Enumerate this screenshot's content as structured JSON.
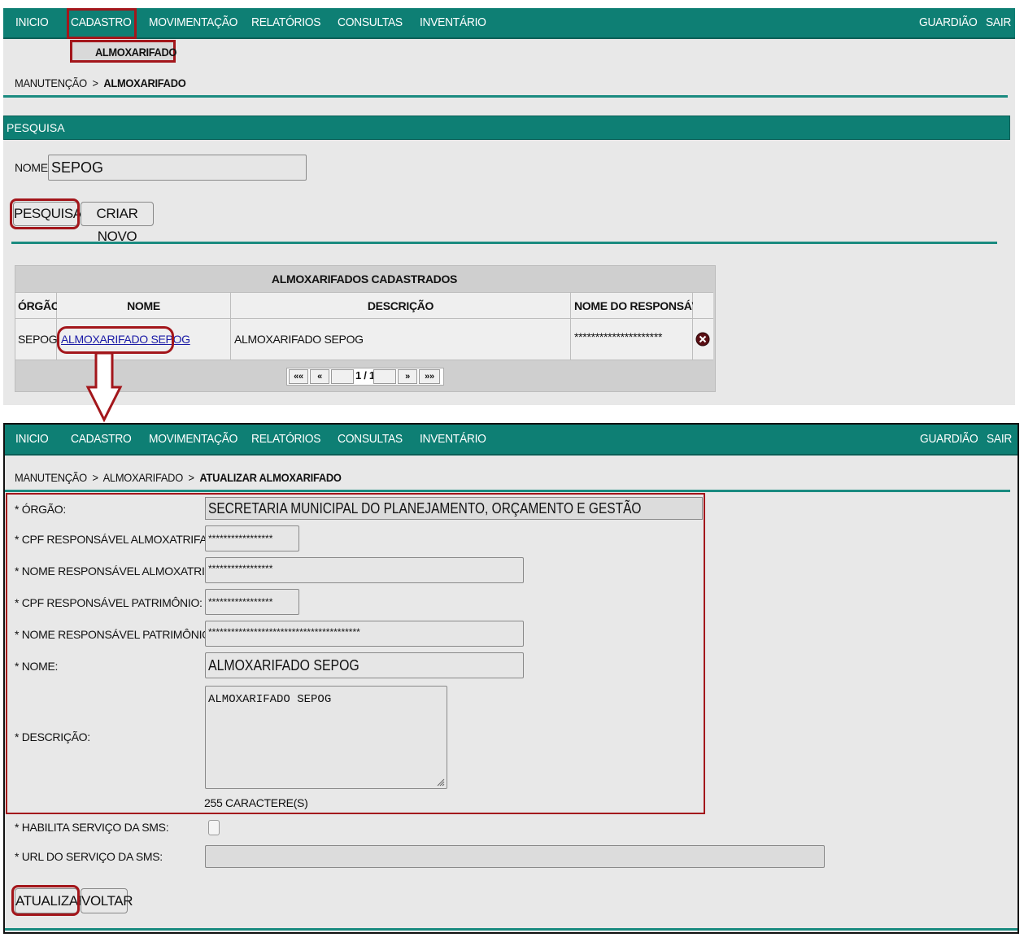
{
  "nav": {
    "items": [
      "INICIO",
      "CADASTRO",
      "MOVIMENTAÇÃO",
      "RELATÓRIOS",
      "CONSULTAS",
      "INVENTÁRIO"
    ],
    "right_items": [
      "GUARDIÃO",
      "SAIR"
    ],
    "submenu_item": "ALMOXARIFADO"
  },
  "top": {
    "breadcrumb": {
      "first": "MANUTENÇÃO",
      "sep": ">",
      "current": "ALMOXARIFADO"
    },
    "search_section": "PESQUISA",
    "name_label": "NOME:",
    "name_value": "SEPOG",
    "search_button": "PESQUISAR",
    "create_button": "CRIAR NOVO",
    "table": {
      "title": "ALMOXARIFADOS CADASTRADOS",
      "headers": [
        "ÓRGÃO",
        "NOME",
        "DESCRIÇÃO",
        "NOME DO RESPONSÁVEL"
      ],
      "rows": [
        {
          "orgao": "SEPOG",
          "nome": "ALMOXARIFADO SEPOG",
          "descricao": "ALMOXARIFADO SEPOG",
          "responsavel": "*********************"
        }
      ],
      "pagination": {
        "first": "««",
        "prev": "«",
        "page": "1 / 1",
        "next": "»",
        "last": "»»"
      }
    }
  },
  "bottom": {
    "breadcrumb": {
      "first": "MANUTENÇÃO",
      "sep1": ">",
      "second": "ALMOXARIFADO",
      "sep2": ">",
      "current": "ATUALIZAR ALMOXARIFADO"
    },
    "form": {
      "orgao_label": "* ÓRGÃO:",
      "orgao_value": "SECRETARIA MUNICIPAL DO PLANEJAMENTO, ORÇAMENTO E GESTÃO",
      "cpf_almox_label": "* CPF RESPONSÁVEL ALMOXATRIFADO:",
      "cpf_almox_value": "*****************",
      "nome_almox_label": "* NOME RESPONSÁVEL ALMOXATRIFADO:",
      "nome_almox_value": "*****************",
      "cpf_patr_label": "* CPF RESPONSÁVEL PATRIMÔNIO:",
      "cpf_patr_value": "*****************",
      "nome_patr_label": "* NOME RESPONSÁVEL PATRIMÔNIO:",
      "nome_patr_value": "****************************************",
      "nome_label": "* NOME:",
      "nome_value": "ALMOXARIFADO SEPOG",
      "descricao_label": "* DESCRIÇÃO:",
      "descricao_value": "ALMOXARIFADO SEPOG",
      "char_count": "255 CARACTERE(S)",
      "sms_label": "* HABILITA SERVIÇO DA SMS:",
      "sms_checked": false,
      "url_label": "* URL DO SERVIÇO DA SMS:",
      "url_value": ""
    },
    "update_button": "ATUALIZAR",
    "back_button": "VOLTAR"
  },
  "colors": {
    "nav_bg": "#0e7f74",
    "highlight": "#a3161b",
    "link": "#1a1aa6"
  }
}
